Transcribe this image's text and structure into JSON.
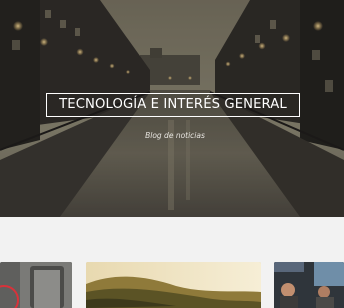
{
  "site": {
    "title": "TECNOLOGÍA E INTERÉS GENERAL",
    "tagline": "Blog de noticias"
  },
  "colors": {
    "title_text": "#ffffff",
    "title_border": "#ffffff",
    "page_background": "#f2f2f2"
  },
  "posts": [
    {
      "image": "phone-device-photo"
    },
    {
      "image": "sunlit-hills-photo"
    },
    {
      "image": "office-people-photo"
    }
  ]
}
